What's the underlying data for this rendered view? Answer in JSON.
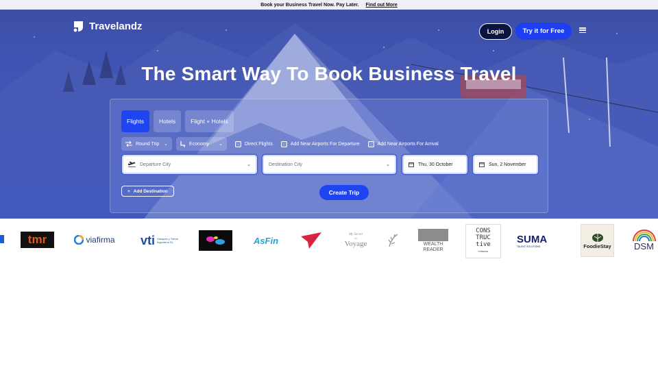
{
  "announcement": {
    "text": "Book your Business Travel Now. Pay Later.",
    "link": "Find out More"
  },
  "nav": {
    "brand": "Travelandz",
    "login": "Login",
    "cta": "Try it for Free"
  },
  "hero": {
    "headline": "The Smart Way To Book Business Travel"
  },
  "search": {
    "tabs": [
      {
        "label": "Flights",
        "active": true
      },
      {
        "label": "Hotels",
        "active": false
      },
      {
        "label": "Flight + Hotels",
        "active": false
      }
    ],
    "trip_type": "Round Trip",
    "cabin": "Economy",
    "options": [
      "Direct Flights",
      "Add Near Airports For Departure",
      "Add Near Airports For Arrival"
    ],
    "departure_placeholder": "Departure City",
    "destination_placeholder": "Destination City",
    "depart_date": "Thu, 30 October",
    "return_date": "Sun, 2 November",
    "add_destination": "Add Destination",
    "create_trip": "Create Trip"
  },
  "partner_logos": {
    "tmr": "tmr",
    "viafirma": "viafirma",
    "vti": "vti",
    "vti_sub": "Vázquez y Torres Ingeniería SL",
    "asfin": "AsFin",
    "mysecretvoyage_1": "My Secret",
    "mysecretvoyage_2": "to",
    "mysecretvoyage_3": "Voyage",
    "wealthreader_1": "WEALTH",
    "wealthreader_2": "READER",
    "constructive_1": "CONS",
    "constructive_2": "TRUC",
    "constructive_3": "tive",
    "constructive_sub": "THINKING",
    "suma": "SUMA",
    "suma_sub": "TALENT SOLUTIONS",
    "foodiestay": "FoodieStay",
    "dsm": "DSM"
  },
  "colors": {
    "accent": "#1f45f2",
    "hero_top": "#3d4fa6",
    "hero_bottom": "#2f52d6"
  }
}
